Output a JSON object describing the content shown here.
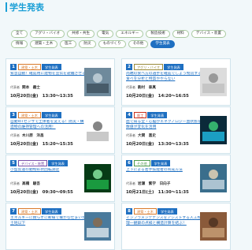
{
  "page_title": "学生発表",
  "filters": {
    "row1": [
      "全て",
      "アグリ・バイオ",
      "共修・共生",
      "電気",
      "エネルギー",
      "製造技術",
      "材料",
      "デバイス・装置"
    ],
    "row2": [
      "情報",
      "建築・土木",
      "医工",
      "防災",
      "ものづくり",
      "その他",
      "学生発表"
    ],
    "selected": "学生発表"
  },
  "cards": [
    {
      "num": "1",
      "tags": [
        {
          "label": "建築・土木",
          "style": "orange"
        },
        {
          "label": "学生発表",
          "style": "blue"
        }
      ],
      "title": "緊急自動！確認用に建物を宣伝を避難させる",
      "presenter_label": "代表者",
      "presenter": "関本　義士",
      "time": "10月20日(金)　13:30～13:35",
      "thumb": "bridge"
    },
    {
      "num": "2",
      "tags": [
        {
          "label": "アグリ・バイオ",
          "style": "olive"
        },
        {
          "label": "学生発表",
          "style": "blue"
        }
      ],
      "title": "両端の食べ方の選手を確認でしょう物流する食べを分析と特質ややらない",
      "presenter_label": "代表者",
      "presenter": "駒村　泰真",
      "time": "10月20日(金)　14:20～16:55",
      "thumb": "gray"
    },
    {
      "num": "3",
      "tags": [
        {
          "label": "建築・土木",
          "style": "orange"
        },
        {
          "label": "学生発表",
          "style": "blue"
        }
      ],
      "title": "自動IoTセンサで土体者を変える！防災・構造物の維持管理への活用！",
      "presenter_label": "代表者",
      "presenter": "木川原　洋昌",
      "time": "10月20日(金)　15:20～15:35",
      "thumb": "device"
    },
    {
      "num": "4",
      "tags": [
        {
          "label": "医工",
          "style": "red"
        },
        {
          "label": "学生発表",
          "style": "blue"
        }
      ],
      "title": "血で知る全・心脳がエネクノロジー血状態を数値が変化を活用",
      "presenter_label": "代表者",
      "presenter": "大関　喜史",
      "time": "10月20日(金)　13:30～13:35",
      "thumb": "neon"
    },
    {
      "num": "5",
      "tags": [
        {
          "label": "デバイス・装置",
          "style": "purple"
        },
        {
          "label": "学生発表",
          "style": "blue"
        }
      ],
      "title": "小型反速の動物形状回転測定",
      "presenter_label": "代表者",
      "presenter": "高橋　駿吾",
      "time": "10月20日(金)　09:30～09:55",
      "thumb": "green"
    },
    {
      "num": "6",
      "tags": [
        {
          "label": "その他",
          "style": "green"
        },
        {
          "label": "学生発表",
          "style": "blue"
        }
      ],
      "title": "上下による若手技能者の育成方法",
      "presenter_label": "代表者",
      "presenter": "岩瀬　繁学　日向子",
      "time": "10月21日(土)　11:30～11:35",
      "thumb": "people"
    },
    {
      "num": "7",
      "tags": [
        {
          "label": "建築・土木",
          "style": "orange"
        },
        {
          "label": "学生発表",
          "style": "blue"
        }
      ],
      "title": "エネルギーに耐らずに断線で壊かな仕まいた土地以下",
      "presenter_label": "",
      "presenter": "",
      "time": "",
      "thumb": "house"
    },
    {
      "num": "8",
      "tags": [
        {
          "label": "建築・土木",
          "style": "orange"
        },
        {
          "label": "学生発表",
          "style": "blue"
        }
      ],
      "title": "インフラメンテナンスをアシストする人工物理一観察の点検と構造計算を結ぶ！",
      "presenter_label": "",
      "presenter": "",
      "time": "",
      "thumb": "pipes"
    }
  ]
}
